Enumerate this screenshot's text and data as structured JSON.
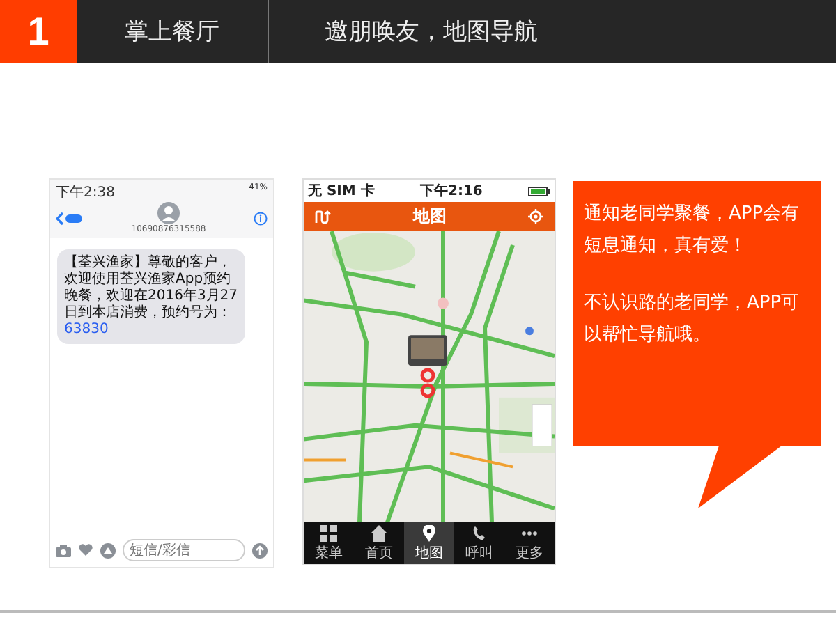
{
  "header": {
    "number": "1",
    "section": "掌上餐厅",
    "title": "邀朋唤友，地图导航"
  },
  "sms_screen": {
    "status_time": "下午2:38",
    "status_battery": "41%",
    "sender": "10690876315588",
    "message": "【荃兴渔家】尊敬的客户，欢迎使用荃兴渔家App预约晚餐，欢迎在2016年3月27日到本店消费，预约号为：",
    "code": "63830",
    "input_placeholder": "短信/彩信"
  },
  "map_screen": {
    "status_carrier": "无 SIM 卡",
    "status_time": "下午2:16",
    "title": "地图",
    "tabs": [
      {
        "label": "菜单",
        "kind": "grid",
        "selected": false
      },
      {
        "label": "首页",
        "kind": "home",
        "selected": false
      },
      {
        "label": "地图",
        "kind": "pin",
        "selected": true
      },
      {
        "label": "呼叫",
        "kind": "phone",
        "selected": false
      },
      {
        "label": "更多",
        "kind": "more",
        "selected": false
      }
    ]
  },
  "callout": {
    "paragraphs": [
      "通知老同学聚餐，APP会有短息通知，真有爱！",
      "不认识路的老同学，APP可以帮忙导航哦。"
    ]
  }
}
